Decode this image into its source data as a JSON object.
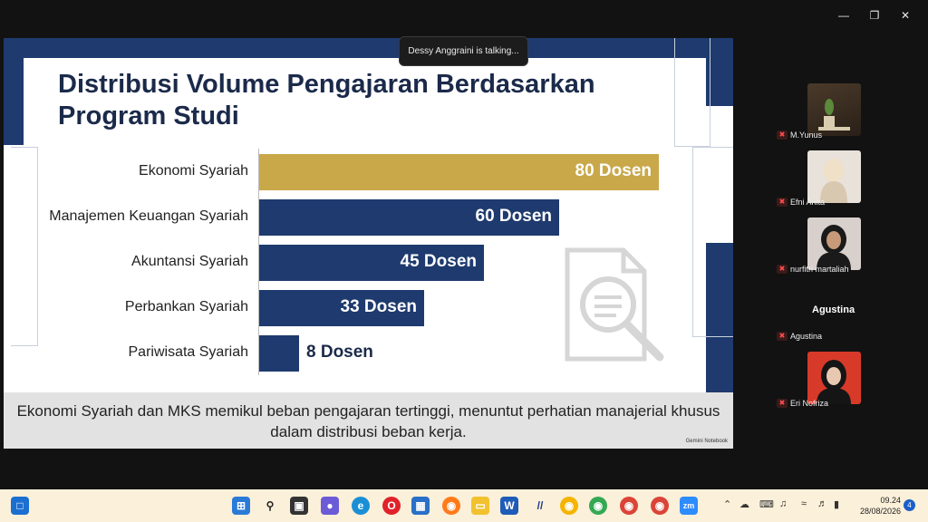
{
  "window": {
    "minimize_icon": "minimize-icon",
    "restore_icon": "restore-icon",
    "close_icon": "close-icon"
  },
  "talking": "Dessy Anggraini is talking...",
  "slide": {
    "title": "Distribusi Volume Pengajaran Berdasarkan Program Studi",
    "footer": "Ekonomi Syariah dan MKS memikul beban pengajaran tertinggi, menuntut perhatian manajerial khusus dalam distribusi beban kerja.",
    "watermark": "Gemini Notebook"
  },
  "chart_data": {
    "type": "bar",
    "orientation": "horizontal",
    "title": "Distribusi Volume Pengajaran Berdasarkan Program Studi",
    "categories": [
      "Ekonomi Syariah",
      "Manajemen Keuangan Syariah",
      "Akuntansi Syariah",
      "Perbankan Syariah",
      "Pariwisata Syariah"
    ],
    "values": [
      80,
      60,
      45,
      33,
      8
    ],
    "data_labels": [
      "80 Dosen",
      "60 Dosen",
      "45 Dosen",
      "33 Dosen",
      "8 Dosen"
    ],
    "colors": [
      "#c9a84a",
      "#1e3a6e",
      "#1e3a6e",
      "#1e3a6e",
      "#1e3a6e"
    ],
    "xlim": [
      0,
      80
    ],
    "grid": false
  },
  "participants": [
    {
      "name": "M.Yunus"
    },
    {
      "name": "Efni Anita"
    },
    {
      "name": "nurfitri martaliah"
    },
    {
      "name": "Agustina"
    },
    {
      "name": "Eri Nofriza"
    }
  ],
  "agustina_tile": "Agustina",
  "taskbar": {
    "clock_time": "09.24",
    "clock_date": "28/08/2026",
    "notifications": "4",
    "zoom_label": "zm"
  }
}
